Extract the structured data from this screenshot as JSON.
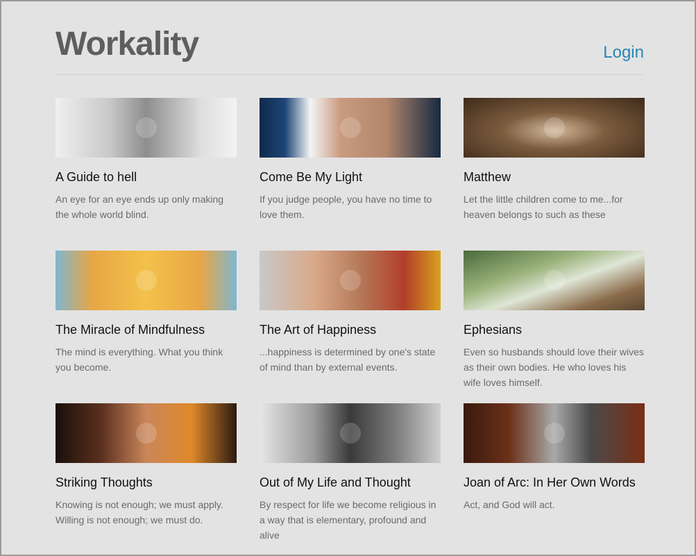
{
  "header": {
    "logo": "Workality",
    "login_label": "Login",
    "accent_color": "#2a86b8"
  },
  "cards": [
    {
      "title": "A Guide to hell",
      "desc": "An eye for an eye ends up only making the whole world blind.",
      "image": "gandhi-portrait"
    },
    {
      "title": "Come Be My Light",
      "desc": "If you judge people, you have no time to love them.",
      "image": "mother-teresa-portrait"
    },
    {
      "title": "Matthew",
      "desc": "Let the little children come to me...for heaven belongs to such as these",
      "image": "shroud-face"
    },
    {
      "title": "The Miracle of Mindfulness",
      "desc": "The mind is everything. What you think you become.",
      "image": "buddha-painting"
    },
    {
      "title": "The Art of Happiness",
      "desc": "...happiness is determined by one's state of mind than by external events.",
      "image": "dalai-lama-portrait"
    },
    {
      "title": "Ephesians",
      "desc": "Even so husbands should love their wives as their own bodies. He who loves his wife loves himself.",
      "image": "jesus-painting"
    },
    {
      "title": "Striking Thoughts",
      "desc": "Knowing is not enough; we must apply. Willing is not enough; we must do.",
      "image": "bruce-lee-photo"
    },
    {
      "title": "Out of My Life and Thought",
      "desc": "By respect for life we become religious in a way that is elementary, profound and alive",
      "image": "schweitzer-photo"
    },
    {
      "title": "Joan of Arc: In Her Own Words",
      "desc": "Act, and God will act.",
      "image": "joan-of-arc-painting"
    }
  ]
}
